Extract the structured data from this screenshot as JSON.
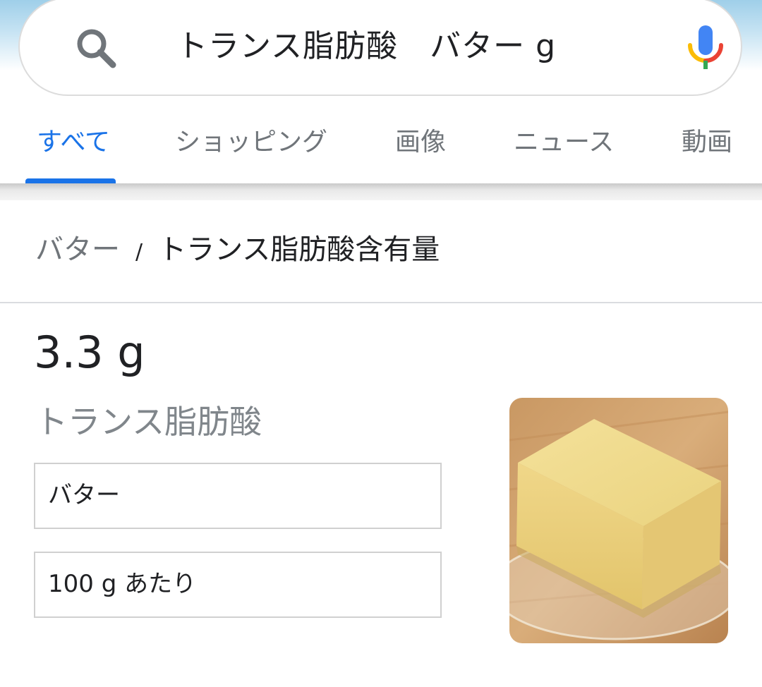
{
  "search": {
    "query": "トランス脂肪酸　バター g"
  },
  "tabs": [
    {
      "label": "すべて",
      "active": true
    },
    {
      "label": "ショッピング",
      "active": false
    },
    {
      "label": "画像",
      "active": false
    },
    {
      "label": "ニュース",
      "active": false
    },
    {
      "label": "動画",
      "active": false
    }
  ],
  "breadcrumb": {
    "parent": "バター",
    "separator": "/",
    "current": "トランス脂肪酸含有量"
  },
  "result": {
    "value": "3.3 g",
    "nutrient": "トランス脂肪酸",
    "food_selector": "バター",
    "unit_selector": "100 g あたり"
  },
  "colors": {
    "accent": "#1a73e8",
    "mic_blue": "#4285f4",
    "mic_red": "#ea4335",
    "mic_yellow": "#fbbc05",
    "mic_green": "#34a853"
  },
  "icons": {
    "search": "search-icon",
    "microphone": "microphone-icon",
    "food_image": "butter-image"
  }
}
